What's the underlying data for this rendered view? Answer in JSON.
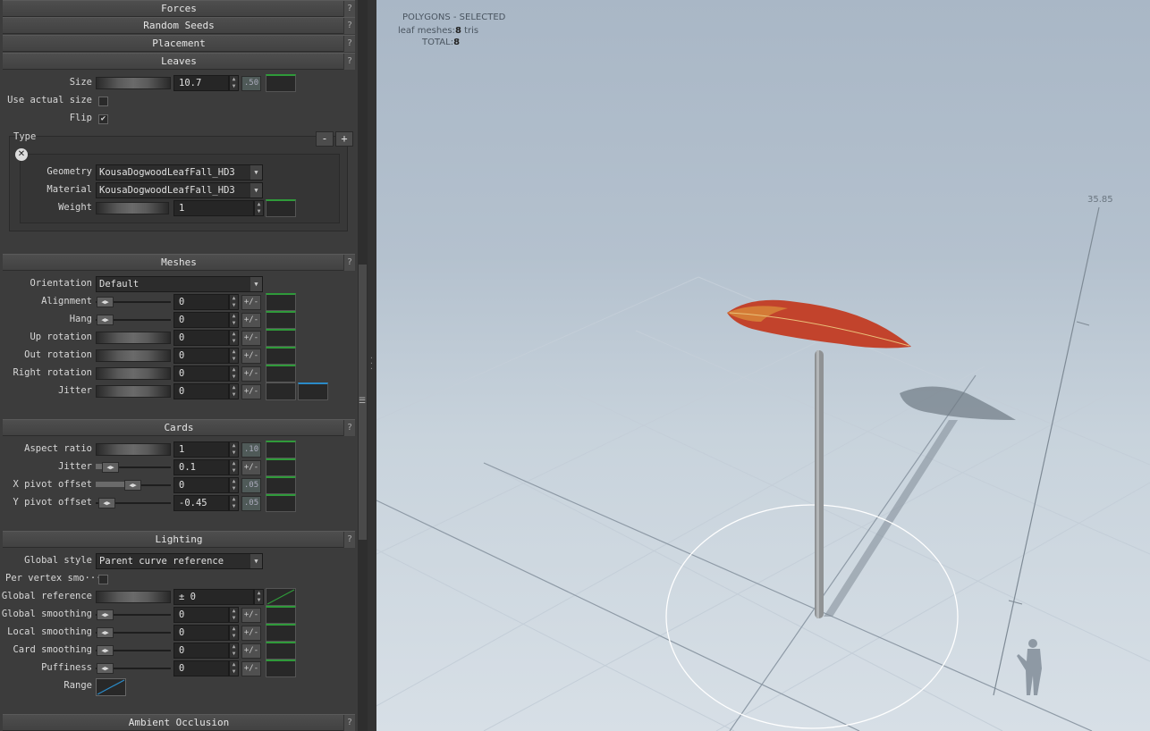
{
  "sections": {
    "forces": "Forces",
    "random_seeds": "Random Seeds",
    "placement": "Placement",
    "leaves": "Leaves",
    "meshes": "Meshes",
    "cards": "Cards",
    "lighting": "Lighting",
    "ambient_occlusion": "Ambient Occlusion"
  },
  "help": "?",
  "leaves": {
    "size_label": "Size",
    "size_value": "10.7",
    "size_step": ".50",
    "use_actual_size_label": "Use actual size",
    "use_actual_size_checked": false,
    "flip_label": "Flip",
    "flip_mark": "✔",
    "type_label": "Type",
    "minus": "-",
    "plus": "+",
    "close": "✕",
    "geometry_label": "Geometry",
    "geometry_value": "KousaDogwoodLeafFall_HD3",
    "material_label": "Material",
    "material_value": "KousaDogwoodLeafFall_HD3",
    "weight_label": "Weight",
    "weight_value": "1"
  },
  "meshes": {
    "orientation_label": "Orientation",
    "orientation_value": "Default",
    "alignment_label": "Alignment",
    "alignment_value": "0",
    "hang_label": "Hang",
    "hang_value": "0",
    "up_rotation_label": "Up rotation",
    "up_rotation_value": "0",
    "out_rotation_label": "Out rotation",
    "out_rotation_value": "0",
    "right_rotation_label": "Right rotation",
    "right_rotation_value": "0",
    "jitter_label": "Jitter",
    "jitter_value": "0",
    "pm_label": "+/-"
  },
  "cards": {
    "aspect_ratio_label": "Aspect ratio",
    "aspect_ratio_value": "1",
    "aspect_ratio_step": ".10",
    "jitter_label": "Jitter",
    "jitter_value": "0.1",
    "x_pivot_label": "X pivot offset",
    "x_pivot_value": "0",
    "x_pivot_step": ".05",
    "y_pivot_label": "Y pivot offset",
    "y_pivot_value": "-0.45",
    "y_pivot_step": ".05"
  },
  "lighting": {
    "global_style_label": "Global style",
    "global_style_value": "Parent curve reference",
    "per_vertex_label": "Per vertex smo···",
    "global_reference_label": "Global reference",
    "global_reference_value": "± 0",
    "global_smoothing_label": "Global smoothing",
    "global_smoothing_value": "0",
    "local_smoothing_label": "Local smoothing",
    "local_smoothing_value": "0",
    "card_smoothing_label": "Card smoothing",
    "card_smoothing_value": "0",
    "puffiness_label": "Puffiness",
    "puffiness_value": "0",
    "range_label": "Range"
  },
  "viewport": {
    "hud_title": "POLYGONS - SELECTED",
    "hud_leaf_label": "leaf meshes:",
    "hud_leaf_count": "8",
    "hud_leaf_unit": "tris",
    "hud_total_label": "TOTAL:",
    "hud_total_count": "8",
    "ruler_value": "35.85"
  },
  "colors": {
    "curve_green": "#2f9a3a",
    "curve_blue": "#2a8bc8",
    "leaf_red": "#c8402a",
    "viewport_top": "#a9b7c6"
  },
  "icons": {
    "help": "question-icon",
    "close": "close-circle-icon",
    "dropdown": "chevron-down-icon",
    "stepper": "spin-arrows-icon",
    "slider_knob": "left-right-arrows-icon"
  }
}
